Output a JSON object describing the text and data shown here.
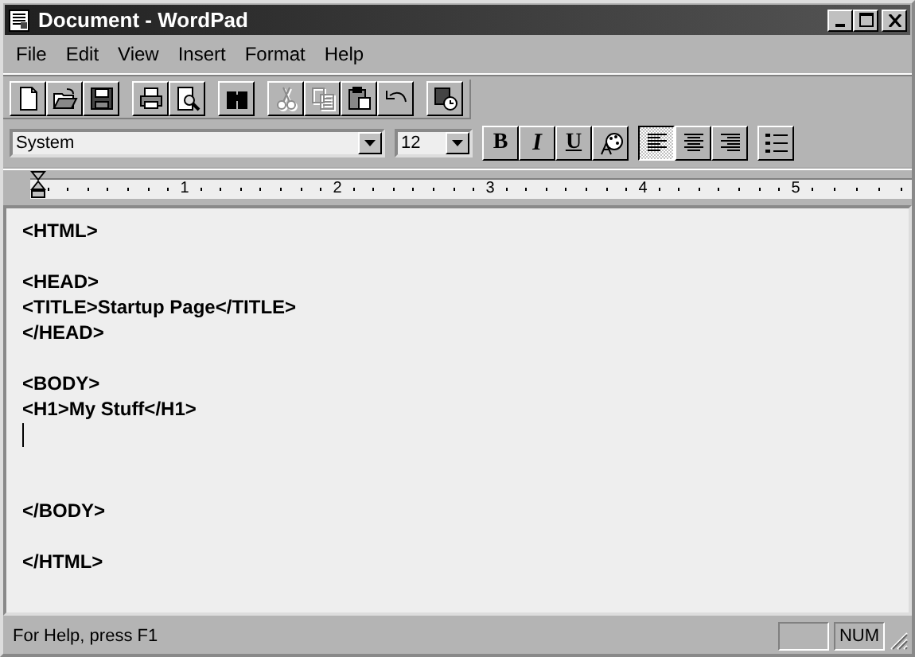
{
  "window": {
    "title": "Document - WordPad"
  },
  "menu": [
    {
      "label": "File"
    },
    {
      "label": "Edit"
    },
    {
      "label": "View"
    },
    {
      "label": "Insert"
    },
    {
      "label": "Format"
    },
    {
      "label": "Help"
    }
  ],
  "toolbar": {
    "groups": [
      [
        {
          "kind": "new",
          "disabled": false
        },
        {
          "kind": "open",
          "disabled": false
        },
        {
          "kind": "save",
          "disabled": false
        }
      ],
      [
        {
          "kind": "print",
          "disabled": false
        },
        {
          "kind": "preview",
          "disabled": false
        }
      ],
      [
        {
          "kind": "find",
          "disabled": false
        }
      ],
      [
        {
          "kind": "cut",
          "disabled": true
        },
        {
          "kind": "copy",
          "disabled": true
        },
        {
          "kind": "paste",
          "disabled": false
        },
        {
          "kind": "undo",
          "disabled": false
        }
      ],
      [
        {
          "kind": "datetime",
          "disabled": false
        }
      ]
    ]
  },
  "format_bar": {
    "font": "System",
    "size": "12",
    "groups": [
      [
        {
          "kind": "bold",
          "label": "B",
          "selected": false
        },
        {
          "kind": "italic",
          "label": "I",
          "selected": false
        },
        {
          "kind": "underline",
          "label": "U",
          "selected": false
        },
        {
          "kind": "color",
          "selected": false
        }
      ],
      [
        {
          "kind": "align_left",
          "selected": true
        },
        {
          "kind": "align_center",
          "selected": false
        },
        {
          "kind": "align_right",
          "selected": false
        }
      ],
      [
        {
          "kind": "bullets",
          "selected": false
        }
      ]
    ]
  },
  "ruler": {
    "labels": [
      "1",
      "2",
      "3",
      "4",
      "5"
    ]
  },
  "document": {
    "lines": [
      {
        "kind": "text",
        "text": "<HTML>"
      },
      {
        "kind": "blank"
      },
      {
        "kind": "text",
        "text": "<HEAD>"
      },
      {
        "kind": "text",
        "text": "<TITLE>Startup Page</TITLE>"
      },
      {
        "kind": "text",
        "text": "</HEAD>"
      },
      {
        "kind": "blank"
      },
      {
        "kind": "text",
        "text": "<BODY>"
      },
      {
        "kind": "text",
        "text": "<H1>My Stuff</H1>"
      },
      {
        "kind": "cursor"
      },
      {
        "kind": "blank"
      },
      {
        "kind": "blank"
      },
      {
        "kind": "text",
        "text": "</BODY>"
      },
      {
        "kind": "blank"
      },
      {
        "kind": "text",
        "text": "</HTML>"
      }
    ]
  },
  "status_bar": {
    "text": "For Help, press F1",
    "indicator": "NUM"
  }
}
